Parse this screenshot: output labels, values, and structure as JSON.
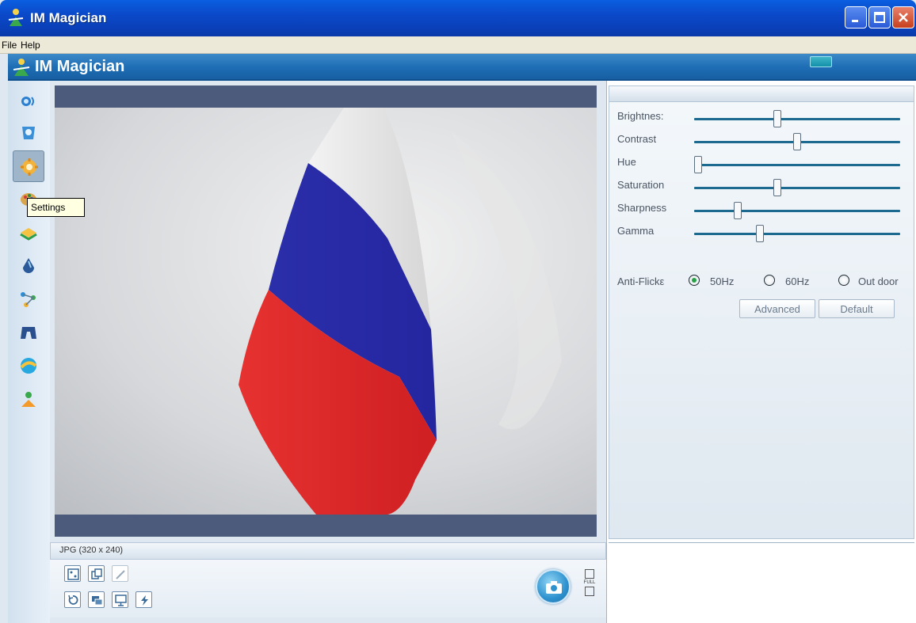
{
  "window": {
    "title": "IM Magician"
  },
  "menu": {
    "file": "File",
    "help": "Help"
  },
  "header": {
    "app_name": "IM Magician"
  },
  "sidebar": {
    "tooltip": "Settings",
    "items": [
      {
        "icon": "webcam-icon"
      },
      {
        "icon": "effects-icon"
      },
      {
        "icon": "settings-icon",
        "active": true
      },
      {
        "icon": "palette-icon"
      },
      {
        "icon": "frames-icon"
      },
      {
        "icon": "drop-icon"
      },
      {
        "icon": "network-icon"
      },
      {
        "icon": "gamepad-icon"
      },
      {
        "icon": "globe-icon"
      },
      {
        "icon": "user-icon"
      }
    ]
  },
  "video": {
    "format_label": "JPG (320 x 240)"
  },
  "toolbar": {
    "buttons": [
      {
        "icon": "grid-icon"
      },
      {
        "icon": "copy-icon"
      },
      {
        "icon": "pencil-icon"
      },
      {
        "icon": "rotate-icon"
      },
      {
        "icon": "windows-icon"
      },
      {
        "icon": "monitor-icon"
      },
      {
        "icon": "flash-icon"
      }
    ],
    "full_label": "FULL"
  },
  "settings": {
    "sliders": [
      {
        "label": "Brightnes:",
        "value": 0.4
      },
      {
        "label": "Contrast",
        "value": 0.5
      },
      {
        "label": "Hue",
        "value": 0.0
      },
      {
        "label": "Saturation",
        "value": 0.4
      },
      {
        "label": "Sharpness",
        "value": 0.2
      },
      {
        "label": "Gamma",
        "value": 0.31
      }
    ],
    "anti_flicker": {
      "label": "Anti-Flickε",
      "options": [
        {
          "label": "50Hz",
          "selected": true
        },
        {
          "label": "60Hz",
          "selected": false
        },
        {
          "label": "Out door",
          "selected": false
        }
      ]
    },
    "advanced_label": "Advanced",
    "default_label": "Default"
  }
}
